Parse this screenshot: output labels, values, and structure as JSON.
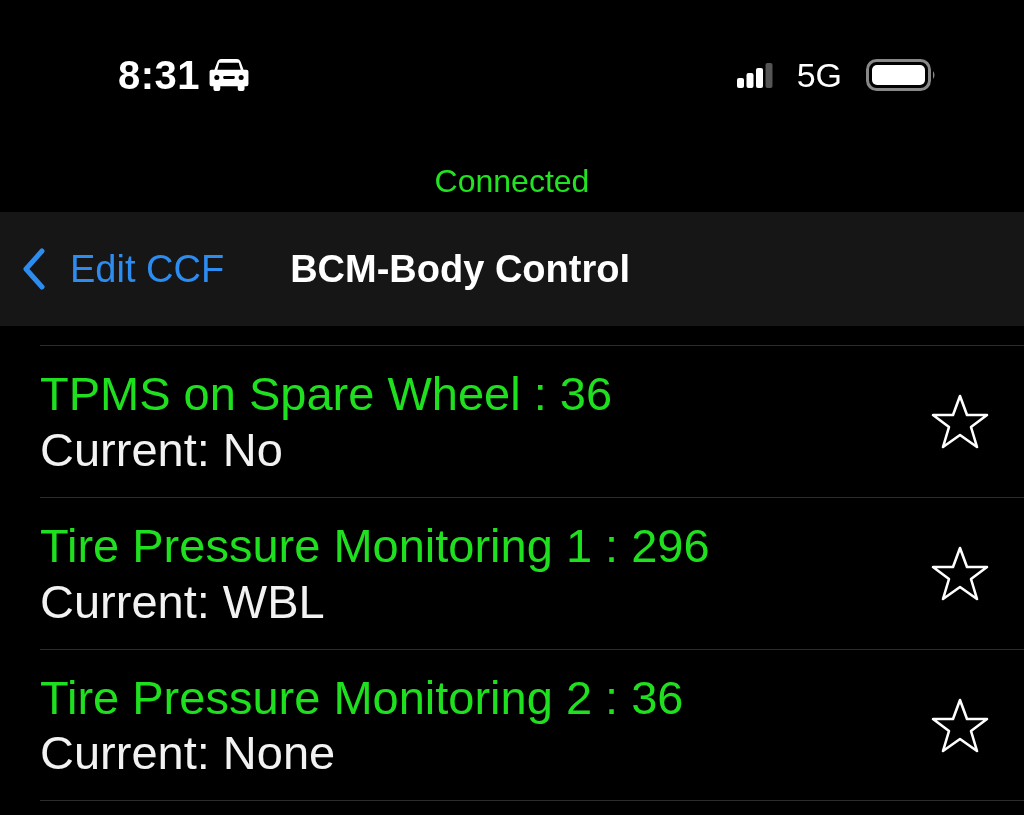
{
  "status_bar": {
    "time": "8:31",
    "network": "5G"
  },
  "connection_status": "Connected",
  "nav_bar": {
    "back_label": "Edit CCF",
    "title": "BCM-Body Control"
  },
  "rows": [
    {
      "title": "TPMS on Spare Wheel : 36",
      "current": "Current: No",
      "favorite": false
    },
    {
      "title": "Tire Pressure Monitoring 1 : 296",
      "current": "Current: WBL",
      "favorite": false
    },
    {
      "title": "Tire Pressure Monitoring 2 : 36",
      "current": "Current: None",
      "favorite": false
    }
  ]
}
